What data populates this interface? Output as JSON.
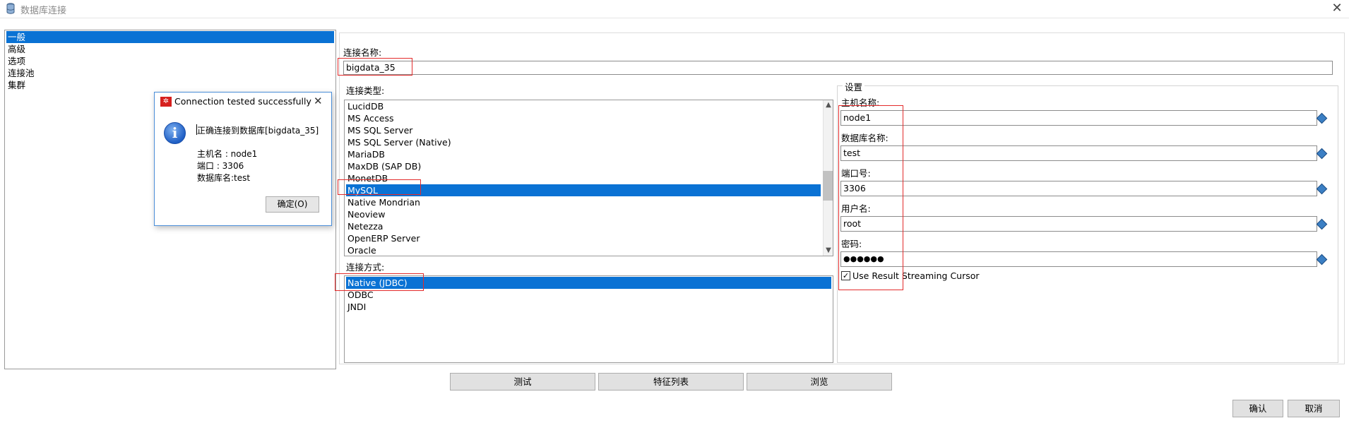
{
  "window": {
    "title": "数据库连接",
    "close_glyph": "✕",
    "icon": "database-icon"
  },
  "nav": {
    "items": [
      {
        "label": "一般",
        "selected": true
      },
      {
        "label": "高级",
        "selected": false
      },
      {
        "label": "选项",
        "selected": false
      },
      {
        "label": "连接池",
        "selected": false
      },
      {
        "label": "集群",
        "selected": false
      }
    ]
  },
  "connection": {
    "name_label": "连接名称:",
    "name_value": "bigdata_35",
    "type_label": "连接类型:",
    "types": [
      "LucidDB",
      "MS Access",
      "MS SQL Server",
      "MS SQL Server (Native)",
      "MariaDB",
      "MaxDB (SAP DB)",
      "MonetDB",
      "MySQL",
      "Native Mondrian",
      "Neoview",
      "Netezza",
      "OpenERP Server",
      "Oracle"
    ],
    "selected_type": "MySQL",
    "access_label": "连接方式:",
    "access_methods": [
      "Native (JDBC)",
      "ODBC",
      "JNDI"
    ],
    "selected_access": "Native (JDBC)"
  },
  "settings": {
    "group_title": "设置",
    "host_label": "主机名称:",
    "host_value": "node1",
    "db_label": "数据库名称:",
    "db_value": "test",
    "port_label": "端口号:",
    "port_value": "3306",
    "user_label": "用户名:",
    "user_value": "root",
    "password_label": "密码:",
    "password_value": "●●●●●●",
    "streaming_label": "Use Result Streaming Cursor",
    "streaming_checked": true,
    "variable_icon": "variable-diamond-icon"
  },
  "buttons": {
    "test": "测试",
    "features": "特征列表",
    "explore": "浏览",
    "ok": "确认",
    "cancel": "取消"
  },
  "popup": {
    "title": "Connection tested successfully",
    "close_glyph": "✕",
    "message": "正确连接到数据库[bigdata_35]",
    "host_line": "主机名       : node1",
    "port_line": "端口           : 3306",
    "db_line": "数据库名:test",
    "ok_button": "确定(O)",
    "info_glyph": "i"
  },
  "colors": {
    "selection": "#0a72d4",
    "annotation": "#e32b2b"
  }
}
